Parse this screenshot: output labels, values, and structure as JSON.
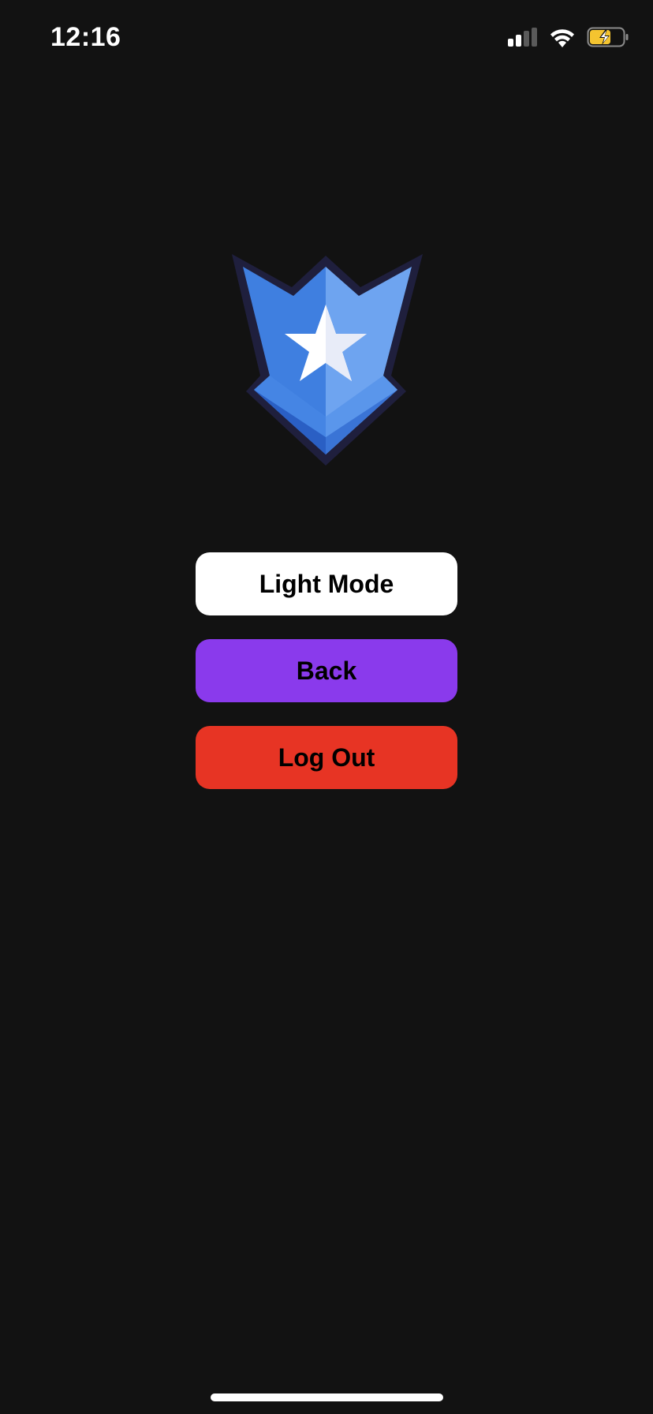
{
  "status_bar": {
    "time": "12:16",
    "icons": [
      "cellular-signal-icon",
      "wifi-icon",
      "battery-charging-icon"
    ],
    "battery_color": "#f4c430"
  },
  "logo": {
    "icon": "shield-star-icon",
    "colors": {
      "primary": "#4a8be8",
      "light": "#7aaef5",
      "dark": "#2a5fc4",
      "outline": "#1f1f3d",
      "star": "#ffffff"
    }
  },
  "buttons": {
    "light_mode": "Light Mode",
    "back": "Back",
    "log_out": "Log Out"
  },
  "colors": {
    "background": "#121212",
    "light_mode_button": "#ffffff",
    "back_button": "#8a3aec",
    "log_out_button": "#e73424"
  }
}
